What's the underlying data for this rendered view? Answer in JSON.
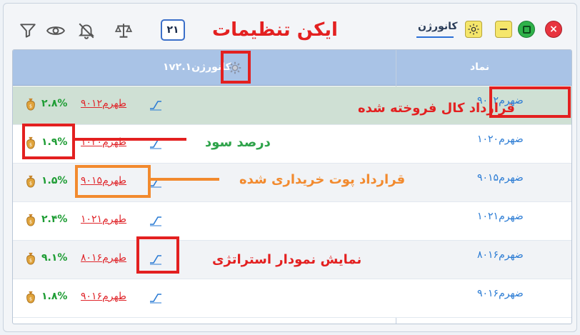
{
  "titlebar": {
    "count": "۲۱",
    "annotation_title": "ایکن تنظیمات",
    "tab_label": "کانورژن",
    "icons": [
      "filter-icon",
      "eye-icon",
      "bell-off-icon",
      "scale-icon"
    ]
  },
  "table": {
    "header_symbol": "نماد",
    "header_strategy": "کانورژن۱v۲.۱",
    "rows": [
      {
        "symbol": "ضهرم۹۰۱۲",
        "sell": "طهرم۹۰۱۲",
        "pct": "۲.۸%",
        "highlight": true
      },
      {
        "symbol": "ضهرم۱۰۲۰",
        "sell": "طهرم۱۰۲۰",
        "pct": "۱.۹%",
        "highlight": false
      },
      {
        "symbol": "ضهرم۹۰۱۵",
        "sell": "طهرم۹۰۱۵",
        "pct": "۱.۵%",
        "highlight": false
      },
      {
        "symbol": "ضهرم۱۰۲۱",
        "sell": "طهرم۱۰۲۱",
        "pct": "۲.۴%",
        "highlight": false
      },
      {
        "symbol": "ضهرم۸۰۱۶",
        "sell": "طهرم۸۰۱۶",
        "pct": "۹.۱%",
        "highlight": false
      },
      {
        "symbol": "ضهرم۹۰۱۶",
        "sell": "طهرم۹۰۱۶",
        "pct": "۱.۸%",
        "highlight": false
      }
    ]
  },
  "annotations": {
    "call_sold": "قرارداد کال فروخته شده",
    "profit_pct": "درصد سود",
    "put_bought": "قرارداد پوت خریداری شده",
    "show_chart": "نمایش نمودار استراتژی"
  },
  "colors": {
    "header_bg": "#a9c3e6",
    "row_highlight": "#cfe0d4",
    "row_alt": "#f1f3f6",
    "annotation_red": "#e32020",
    "annotation_orange": "#f28a2e",
    "link_blue": "#2a7bd4",
    "profit_green": "#1f9d35"
  }
}
